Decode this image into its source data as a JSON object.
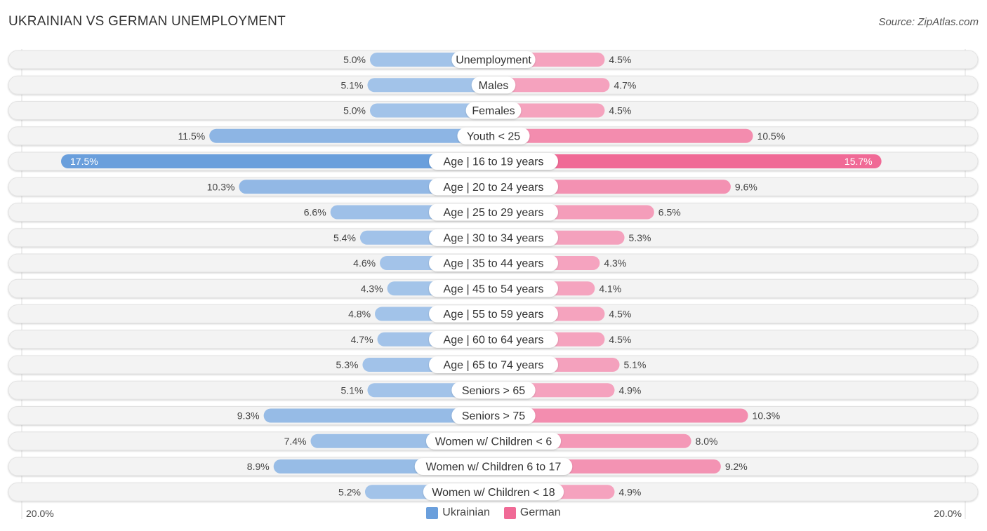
{
  "header": {
    "title": "UKRAINIAN VS GERMAN UNEMPLOYMENT",
    "source": "Source: ZipAtlas.com"
  },
  "colors": {
    "ukrainian": "#6a9fdc",
    "ukrainian_light": "#a7c6ea",
    "german": "#f06a96",
    "german_light": "#f5a8c2",
    "row_bg": "#f3f3f3"
  },
  "chart_data": {
    "type": "bar",
    "orientation": "horizontal-diverging",
    "title": "UKRAINIAN VS GERMAN UNEMPLOYMENT",
    "xlabel": "",
    "ylabel": "",
    "xlim": [
      -20,
      20
    ],
    "axis_tick_labels": {
      "left": "20.0%",
      "right": "20.0%"
    },
    "legend": {
      "position": "bottom-center",
      "entries": [
        "Ukrainian",
        "German"
      ]
    },
    "categories": [
      "Unemployment",
      "Males",
      "Females",
      "Youth < 25",
      "Age | 16 to 19 years",
      "Age | 20 to 24 years",
      "Age | 25 to 29 years",
      "Age | 30 to 34 years",
      "Age | 35 to 44 years",
      "Age | 45 to 54 years",
      "Age | 55 to 59 years",
      "Age | 60 to 64 years",
      "Age | 65 to 74 years",
      "Seniors > 65",
      "Seniors > 75",
      "Women w/ Children < 6",
      "Women w/ Children 6 to 17",
      "Women w/ Children < 18"
    ],
    "series": [
      {
        "name": "Ukrainian",
        "side": "left",
        "values": [
          5.0,
          5.1,
          5.0,
          11.5,
          17.5,
          10.3,
          6.6,
          5.4,
          4.6,
          4.3,
          4.8,
          4.7,
          5.3,
          5.1,
          9.3,
          7.4,
          8.9,
          5.2
        ]
      },
      {
        "name": "German",
        "side": "right",
        "values": [
          4.5,
          4.7,
          4.5,
          10.5,
          15.7,
          9.6,
          6.5,
          5.3,
          4.3,
          4.1,
          4.5,
          4.5,
          5.1,
          4.9,
          10.3,
          8.0,
          9.2,
          4.9
        ]
      }
    ],
    "value_format": "{v}%"
  }
}
